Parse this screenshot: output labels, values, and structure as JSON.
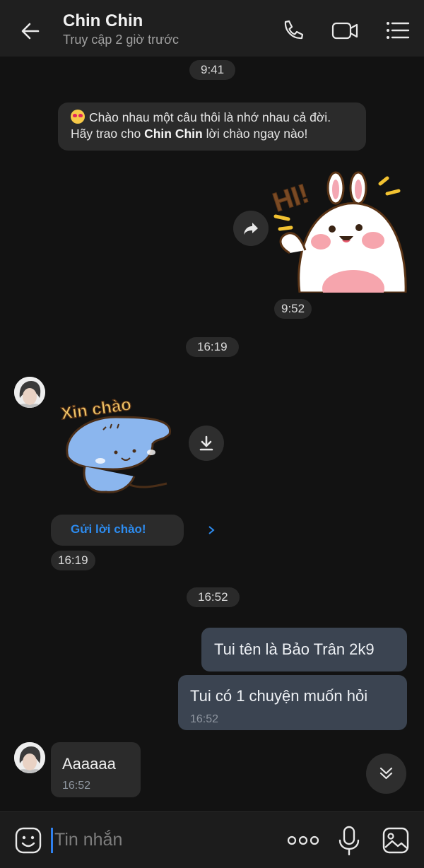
{
  "header": {
    "title": "Chin Chin",
    "status": "Truy cập 2 giờ trước",
    "icons": [
      "back-arrow-icon",
      "phone-icon",
      "video-call-icon",
      "menu-list-icon"
    ]
  },
  "timestamps": {
    "t1": "9:41",
    "t2": "9:52",
    "t3": "16:19",
    "t4": "16:19",
    "t5": "16:52"
  },
  "system_message": {
    "text_before": "Chào nhau một câu thôi là nhớ nhau cả đời. Hãy trao cho ",
    "name": "Chin Chin",
    "text_after": " lời chào ngay nào!"
  },
  "stickers": {
    "sent_text": "HI!",
    "received_text": "Xin chào"
  },
  "greet_button": {
    "label": "Gửi lời chào!"
  },
  "messages": [
    {
      "direction": "out",
      "text": "Tui tên là Bảo Trân 2k9"
    },
    {
      "direction": "out",
      "text": "Tui có 1 chuyện muốn hỏi",
      "time": "16:52"
    },
    {
      "direction": "in",
      "text": "Aaaaaa",
      "time": "16:52"
    }
  ],
  "composer": {
    "placeholder": "Tin nhắn",
    "icons": [
      "sticker-icon",
      "more-icon",
      "microphone-icon",
      "image-icon"
    ]
  },
  "colors": {
    "background": "#121212",
    "header": "#1f1f1f",
    "outgoing_bubble": "#3b4451",
    "incoming_bubble": "#2b2b2b",
    "accent": "#2d8cf0"
  }
}
